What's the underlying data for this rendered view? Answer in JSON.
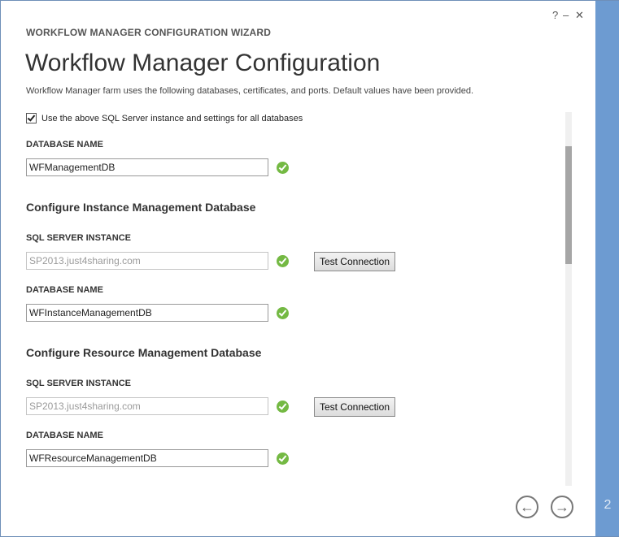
{
  "window": {
    "help_label": "?",
    "minimize_label": "–",
    "close_label": "✕"
  },
  "wizard": {
    "title": "WORKFLOW MANAGER CONFIGURATION WIZARD",
    "step_number": "2"
  },
  "page": {
    "heading": "Workflow Manager Configuration",
    "description": "Workflow Manager farm uses the following databases, certificates, and ports. Default values have been provided."
  },
  "form": {
    "use_same_sql": {
      "label": "Use the above SQL Server instance and settings for all databases",
      "checked": true
    },
    "management_db": {
      "label": "DATABASE NAME",
      "value": "WFManagementDB"
    },
    "instance_section": {
      "title": "Configure Instance Management Database",
      "sql_label": "SQL SERVER INSTANCE",
      "sql_value": "SP2013.just4sharing.com",
      "test_button": "Test Connection",
      "db_label": "DATABASE NAME",
      "db_value": "WFInstanceManagementDB"
    },
    "resource_section": {
      "title": "Configure Resource Management Database",
      "sql_label": "SQL SERVER INSTANCE",
      "sql_value": "SP2013.just4sharing.com",
      "test_button": "Test Connection",
      "db_label": "DATABASE NAME",
      "db_value": "WFResourceManagementDB"
    }
  },
  "navigation": {
    "back_icon": "left-arrow-circle",
    "next_icon": "right-arrow-circle",
    "back_label": "←",
    "next_label": "→"
  },
  "colors": {
    "rail": "#6d9bd1",
    "check": "#74b943"
  }
}
